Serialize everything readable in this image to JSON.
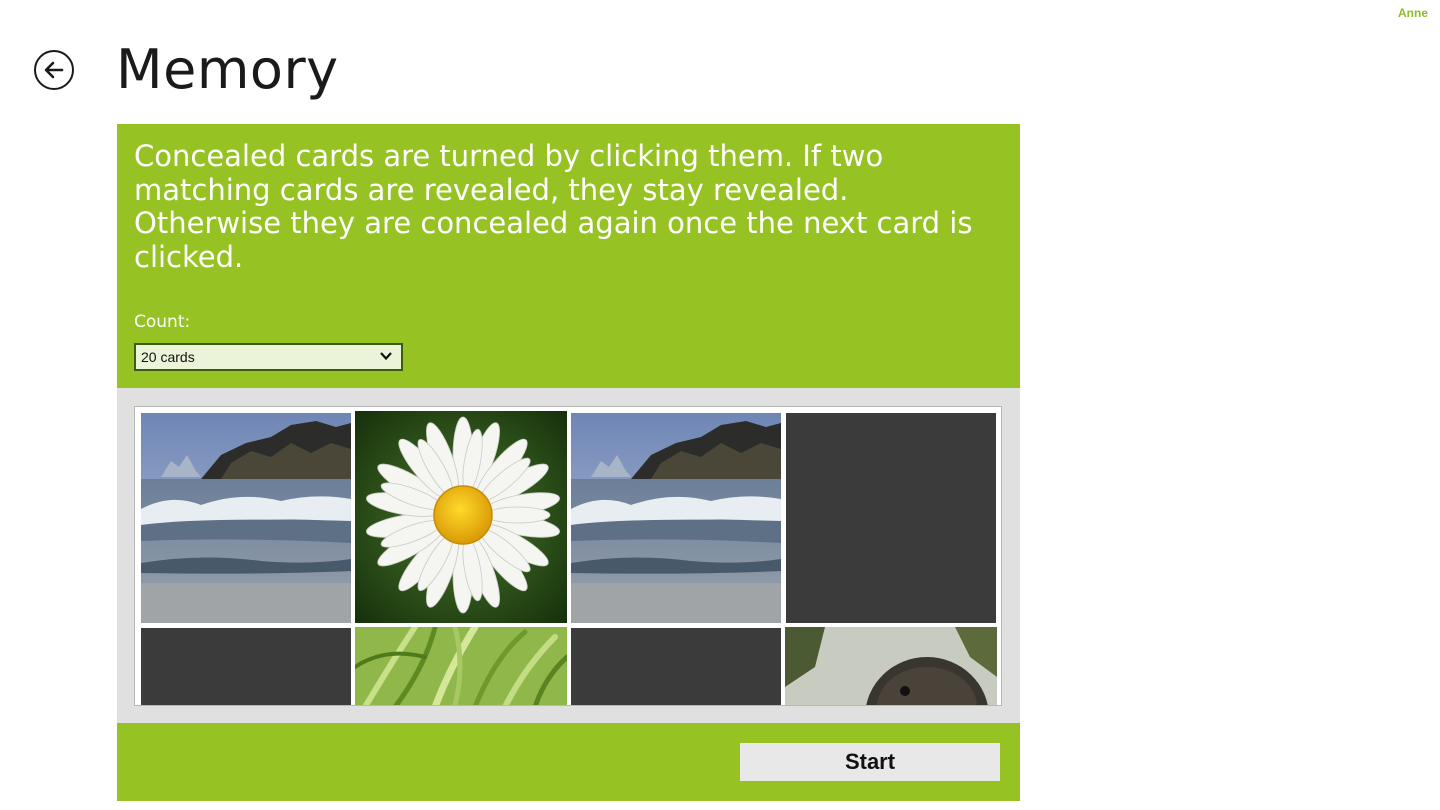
{
  "user": {
    "name": "Anne"
  },
  "header": {
    "title": "Memory",
    "back_icon": "arrow-left-circle-icon"
  },
  "info": {
    "description": "Concealed cards are turned by clicking them. If two matching cards are revealed, they stay revealed. Otherwise they are concealed again once the next card is clicked.",
    "count_label": "Count:",
    "count_value": "20 cards"
  },
  "colors": {
    "accent": "#96c323",
    "user_name": "#8dbd27",
    "concealed_card": "#3b3b3b",
    "board_background": "#e0e0e0"
  },
  "cards": [
    {
      "state": "revealed",
      "image": "sea-rocks"
    },
    {
      "state": "revealed",
      "image": "daisy-flower"
    },
    {
      "state": "revealed",
      "image": "sea-rocks"
    },
    {
      "state": "concealed"
    },
    {
      "state": "concealed"
    },
    {
      "state": "revealed",
      "image": "grass"
    },
    {
      "state": "concealed"
    },
    {
      "state": "revealed",
      "image": "duck"
    }
  ],
  "footer": {
    "start_label": "Start"
  }
}
